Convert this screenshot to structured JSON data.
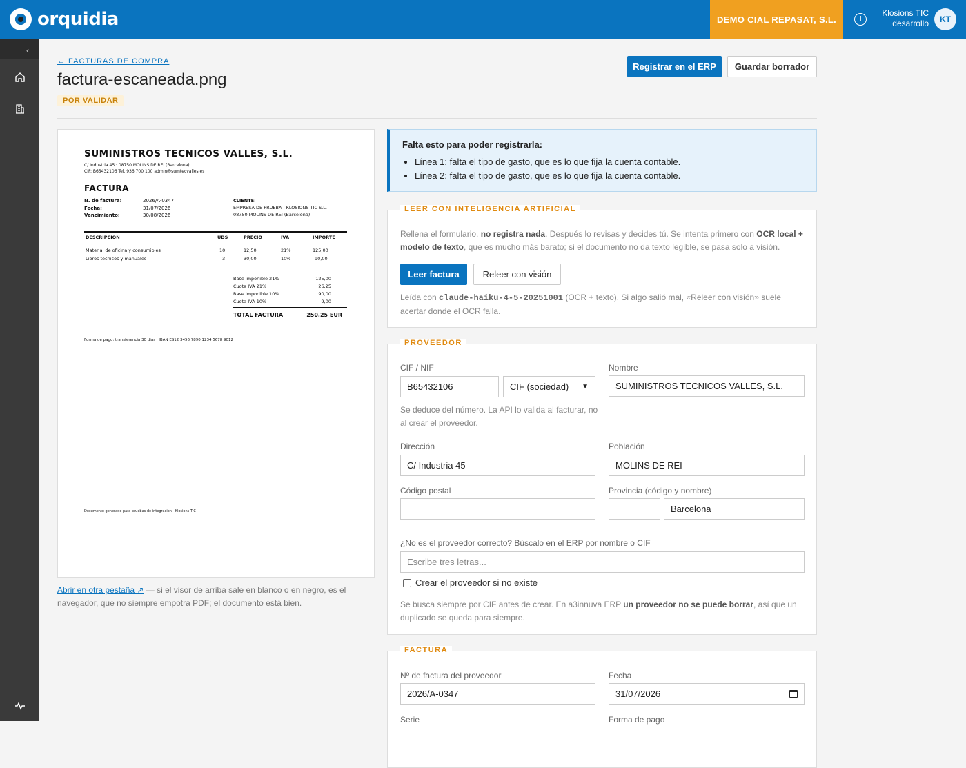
{
  "topbar": {
    "logo_text": "orquidia",
    "company": "DEMO CIAL REPASAT, S.L.",
    "user_name": "Klosions TIC",
    "user_role": "desarrollo",
    "avatar": "KT"
  },
  "sidebar": {
    "collapse": "‹",
    "icons": [
      "home-icon",
      "building-icon",
      "activity-icon"
    ]
  },
  "header": {
    "back_link": "← FACTURAS DE COMPRA",
    "title": "factura-escaneada.png",
    "status": "POR VALIDAR",
    "register_button": "Registrar en el ERP",
    "draft_button": "Guardar borrador"
  },
  "invoice_preview": {
    "company": "SUMINISTROS TECNICOS VALLES, S.L.",
    "address_line": "C/ Industria 45  ·  08750 MOLINS DE REI (Barcelona)",
    "contact_line": "CIF: B65432106   Tel. 936 700 100   admin@sumtecvalles.es",
    "doc_title": "FACTURA",
    "meta": [
      {
        "label": "N. de factura:",
        "value": "2026/A-0347"
      },
      {
        "label": "Fecha:",
        "value": "31/07/2026"
      },
      {
        "label": "Vencimiento:",
        "value": "30/08/2026"
      }
    ],
    "client_label": "CLIENTE:",
    "client_name": "EMPRESA DE PRUEBA · KLOSIONS TIC S.L.",
    "client_address": "08750 MOLINS DE REI (Barcelona)",
    "columns": [
      "DESCRIPCION",
      "UDS",
      "PRECIO",
      "IVA",
      "IMPORTE"
    ],
    "lines": [
      [
        "Material de oficina y consumibles",
        "10",
        "12,50",
        "21%",
        "125,00"
      ],
      [
        "Libros tecnicos y manuales",
        "3",
        "30,00",
        "10%",
        "90,00"
      ]
    ],
    "totals": [
      [
        "Base imponible 21%",
        "125,00"
      ],
      [
        "Cuota IVA 21%",
        "26,25"
      ],
      [
        "Base imponible 10%",
        "90,00"
      ],
      [
        "Cuota IVA 10%",
        "9,00"
      ]
    ],
    "total_label": "TOTAL FACTURA",
    "total_value": "250,25 EUR",
    "payment": "Forma de pago: transferencia 30 dias · IBAN ES12 3456 7890 1234 5678 9012",
    "footer": "Documento generado para pruebas de integracion · Klosions TIC"
  },
  "preview_note": {
    "link": "Abrir en otra pestaña ↗",
    "text": " — si el visor de arriba sale en blanco o en negro, es el navegador, que no siempre empotra PDF; el documento está bien."
  },
  "alert": {
    "title": "Falta esto para poder registrarla:",
    "items": [
      "Línea 1: falta el tipo de gasto, que es lo que fija la cuenta contable.",
      "Línea 2: falta el tipo de gasto, que es lo que fija la cuenta contable."
    ]
  },
  "ai": {
    "legend": "LEER CON INTELIGENCIA ARTIFICIAL",
    "help_1": "Rellena el formulario, ",
    "help_b1": "no registra nada",
    "help_2": ". Después lo revisas y decides tú. Se intenta primero con ",
    "help_b2": "OCR local + modelo de texto",
    "help_3": ", que es mucho más barato; si el documento no da texto legible, se pasa solo a visión.",
    "read_button": "Leer factura",
    "reread_button": "Releer con visión",
    "status_1": "Leída con ",
    "model": "claude-haiku-4-5-20251001",
    "status_2": " (OCR + texto). Si algo salió mal, «Releer con visión» suele acertar donde el OCR falla."
  },
  "proveedor": {
    "legend": "PROVEEDOR",
    "cif_label": "CIF / NIF",
    "cif_value": "B65432106",
    "cif_type": "CIF (sociedad)",
    "cif_help": "Se deduce del número. La API lo valida al facturar, no al crear el proveedor.",
    "nombre_label": "Nombre",
    "nombre_value": "SUMINISTROS TECNICOS VALLES, S.L.",
    "direccion_label": "Dirección",
    "direccion_value": "C/ Industria 45",
    "poblacion_label": "Población",
    "poblacion_value": "MOLINS DE REI",
    "cp_label": "Código postal",
    "cp_value": "",
    "provincia_label": "Provincia (código y nombre)",
    "provincia_code": "",
    "provincia_name": "Barcelona",
    "search_label": "¿No es el proveedor correcto? Búscalo en el ERP por nombre o CIF",
    "search_placeholder": "Escribe tres letras...",
    "create_label": "Crear el proveedor si no existe",
    "note_1": "Se busca siempre por CIF antes de crear. En a3innuva ERP ",
    "note_b": "un proveedor no se puede borrar",
    "note_2": ", así que un duplicado se queda para siempre."
  },
  "factura": {
    "legend": "FACTURA",
    "numero_label": "Nº de factura del proveedor",
    "numero_value": "2026/A-0347",
    "fecha_label": "Fecha",
    "fecha_value": "31/07/2026",
    "serie_label": "Serie",
    "forma_label": "Forma de pago"
  }
}
